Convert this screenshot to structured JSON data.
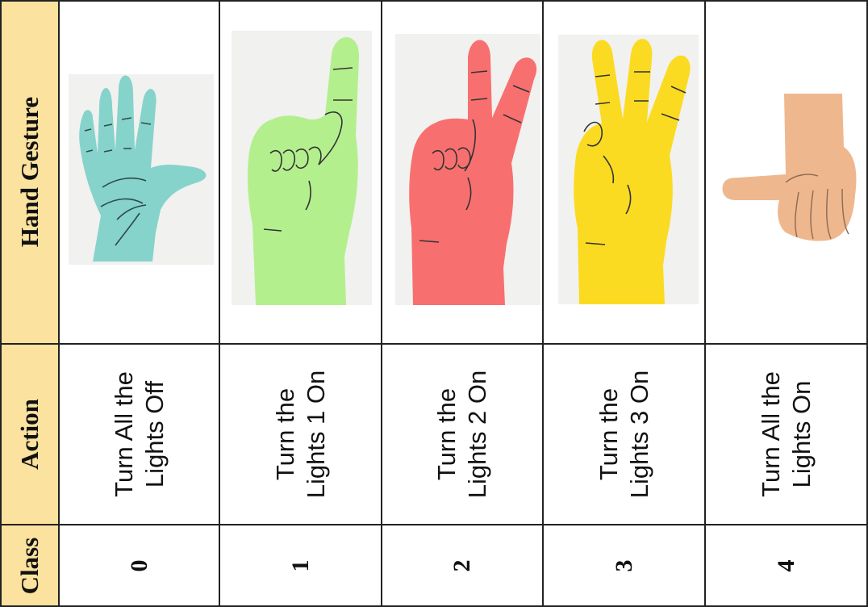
{
  "headers": {
    "gesture": "Hand Gesture",
    "action": "Action",
    "class": "Class"
  },
  "rows": [
    {
      "class": "0",
      "action_line1": "Turn All the",
      "action_line2": "Lights Off",
      "gesture_icon": "open-palm-hand-icon",
      "hand_color": "#86d3cc"
    },
    {
      "class": "1",
      "action_line1": "Turn the",
      "action_line2": "Lights 1 On",
      "gesture_icon": "one-finger-hand-icon",
      "hand_color": "#b4ef8e"
    },
    {
      "class": "2",
      "action_line1": "Turn the",
      "action_line2": "Lights 2 On",
      "gesture_icon": "two-finger-hand-icon",
      "hand_color": "#f7706f"
    },
    {
      "class": "3",
      "action_line1": "Turn the",
      "action_line2": "Lights 3 On",
      "gesture_icon": "three-finger-hand-icon",
      "hand_color": "#fbdb22"
    },
    {
      "class": "4",
      "action_line1": "Turn All the",
      "action_line2": "Lights On",
      "gesture_icon": "thumb-sideways-hand-icon",
      "hand_color": "#efb78e"
    }
  ],
  "colors": {
    "header_bg": "#fbe29e",
    "border": "#222222",
    "photo_bg": "#f1f1ef"
  }
}
